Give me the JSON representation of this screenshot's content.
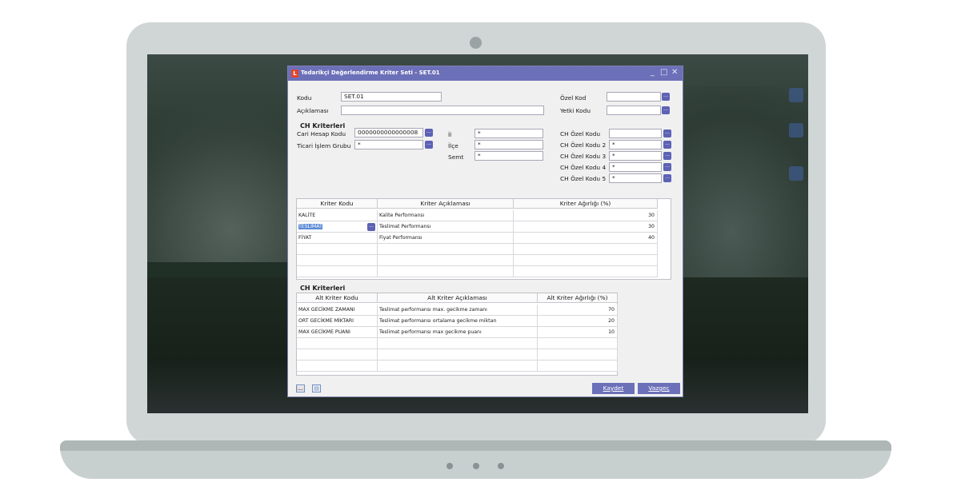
{
  "window": {
    "icon": "L",
    "title": "Tedarikçi Değerlendirme Kriter Seti - SET.01",
    "minimize": "_",
    "maximize": "□",
    "close": "✕"
  },
  "form": {
    "kodu_label": "Kodu",
    "kodu_value": "SET.01",
    "aciklama_label": "Açıklaması",
    "aciklama_value": "",
    "ozel_kod_label": "Özel Kod",
    "ozel_kod_value": "",
    "yetki_kodu_label": "Yetki Kodu",
    "yetki_kodu_value": "",
    "ch_section_title": "CH Kriterleri",
    "cari_label": "Cari Hesap Kodu",
    "cari_value": "0000000000000008",
    "ticari_label": "Ticari İşlem Grubu",
    "ticari_value": "*",
    "il_label": "İl",
    "il_value": "*",
    "ilce_label": "İlçe",
    "ilce_value": "*",
    "semt_label": "Semt",
    "semt_value": "*",
    "ch_ozel_kodu_label": "CH Özel Kodu",
    "ch_ozel_kodu_value": "",
    "ch_ozel_kodu2_label": "CH Özel Kodu 2",
    "ch_ozel_kodu2_value": "*",
    "ch_ozel_kodu3_label": "CH Özel Kodu 3",
    "ch_ozel_kodu3_value": "*",
    "ch_ozel_kodu4_label": "CH Özel Kodu 4",
    "ch_ozel_kodu4_value": "*",
    "ch_ozel_kodu5_label": "CH Özel Kodu 5",
    "ch_ozel_kodu5_value": "*",
    "lookup_glyph": "…"
  },
  "criteria_grid": {
    "headers": [
      "Kriter Kodu",
      "Kriter Açıklaması",
      "Kriter Ağırlığı (%)"
    ],
    "rows": [
      {
        "code": "KALİTE",
        "desc": "Kalite Performansı",
        "weight": "30"
      },
      {
        "code": "TESLİMAT",
        "desc": "Teslimat Performansı",
        "weight": "30"
      },
      {
        "code": "FİYAT",
        "desc": "Fiyat Performansı",
        "weight": "40"
      }
    ]
  },
  "sub_section_title": "CH Kriterleri",
  "sub_grid": {
    "headers": [
      "Alt Kriter Kodu",
      "Alt Kriter Açıklaması",
      "Alt Kriter Ağırlığı (%)"
    ],
    "rows": [
      {
        "code": "MAX GECİKME ZAMANI",
        "desc": "Teslimat performansı max. gecikme zamanı",
        "weight": "70"
      },
      {
        "code": "ORT GECİKME MİKTARI",
        "desc": "Teslimat performansı ortalama gecikme miktarı",
        "weight": "20"
      },
      {
        "code": "MAX GECİKME PUANI",
        "desc": "Teslimat performansı max gecikme puanı",
        "weight": "10"
      }
    ]
  },
  "footer": {
    "save_label": "Kaydet",
    "cancel_label": "Vazgeç",
    "book_icon": "📖",
    "doc_icon": "▤"
  },
  "colors": {
    "titlebar": "#6c70b8",
    "button": "#6c70b8",
    "lookup": "#5d62b5",
    "selection": "#5b8ad6"
  }
}
